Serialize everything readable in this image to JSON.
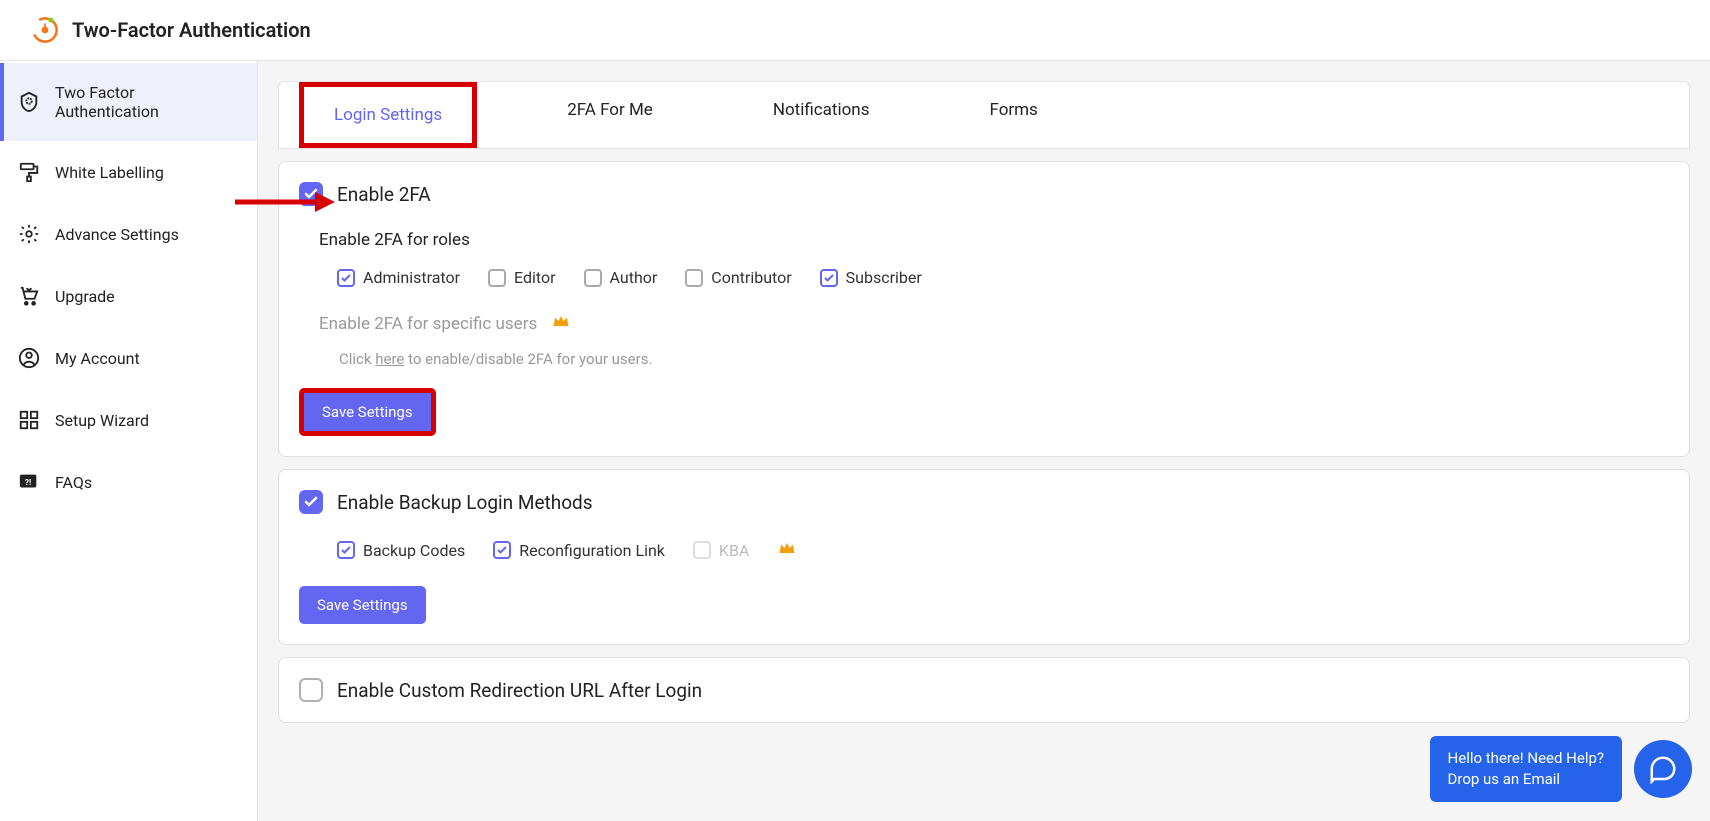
{
  "header": {
    "title": "Two-Factor Authentication"
  },
  "sidebar": {
    "items": [
      {
        "label": "Two Factor Authentication",
        "active": true
      },
      {
        "label": "White Labelling",
        "active": false
      },
      {
        "label": "Advance Settings",
        "active": false
      },
      {
        "label": "Upgrade",
        "active": false
      },
      {
        "label": "My Account",
        "active": false
      },
      {
        "label": "Setup Wizard",
        "active": false
      },
      {
        "label": "FAQs",
        "active": false
      }
    ]
  },
  "tabs": [
    {
      "label": "Login Settings",
      "active": true
    },
    {
      "label": "2FA For Me",
      "active": false
    },
    {
      "label": "Notifications",
      "active": false
    },
    {
      "label": "Forms",
      "active": false
    }
  ],
  "section1": {
    "enable_label": "Enable 2FA",
    "roles_heading": "Enable 2FA for roles",
    "roles": [
      {
        "label": "Administrator",
        "checked": true
      },
      {
        "label": "Editor",
        "checked": false
      },
      {
        "label": "Author",
        "checked": false
      },
      {
        "label": "Contributor",
        "checked": false
      },
      {
        "label": "Subscriber",
        "checked": true
      }
    ],
    "specific_users_label": "Enable 2FA for specific users",
    "hint_prefix": "Click ",
    "hint_link": "here",
    "hint_suffix": " to enable/disable 2FA for your users.",
    "save_label": "Save Settings"
  },
  "section2": {
    "enable_label": "Enable Backup Login Methods",
    "methods": [
      {
        "label": "Backup Codes",
        "checked": true,
        "disabled": false
      },
      {
        "label": "Reconfiguration Link",
        "checked": true,
        "disabled": false
      },
      {
        "label": "KBA",
        "checked": false,
        "disabled": true
      }
    ],
    "save_label": "Save Settings"
  },
  "section3": {
    "enable_label": "Enable Custom Redirection URL After Login"
  },
  "help": {
    "line1": "Hello there! Need Help?",
    "line2": "Drop us an Email"
  }
}
